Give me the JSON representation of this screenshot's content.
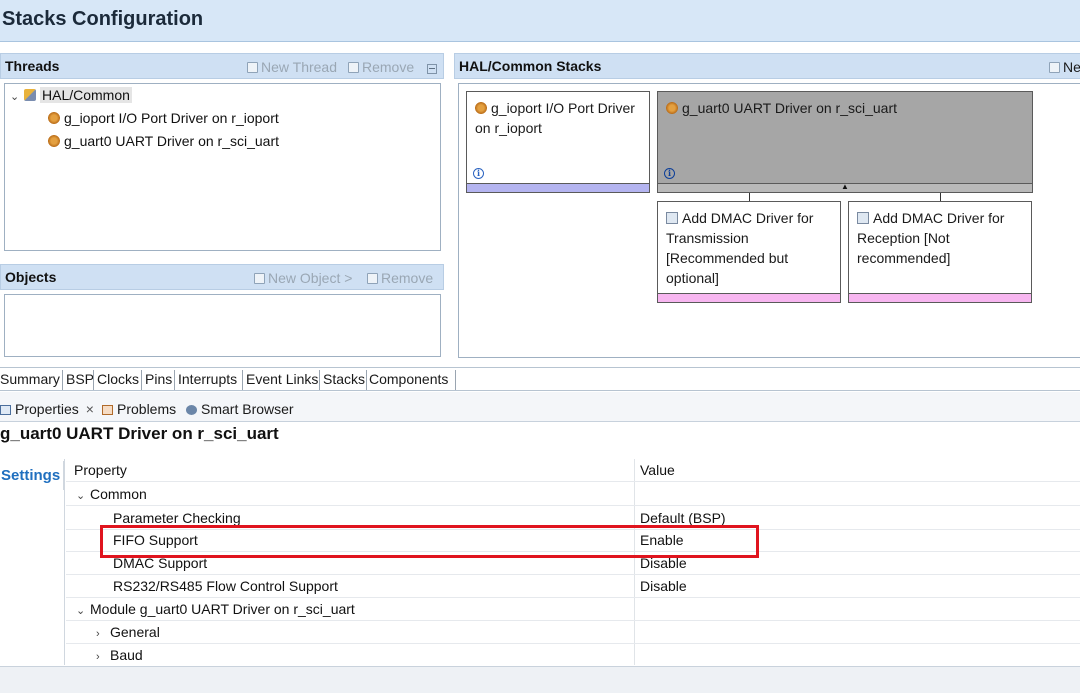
{
  "window": {
    "title": "Stacks Configuration"
  },
  "threads": {
    "header": "Threads",
    "new_thread": "New Thread",
    "remove": "Remove",
    "tree": {
      "root": "HAL/Common",
      "children": [
        "g_ioport I/O Port Driver on r_ioport",
        "g_uart0 UART Driver on r_sci_uart"
      ]
    }
  },
  "objects": {
    "header": "Objects",
    "new_object": "New Object >",
    "remove": "Remove"
  },
  "hal_stacks": {
    "header": "HAL/Common Stacks",
    "new_label": "Ne",
    "cards": {
      "ioport_line1": "g_ioport I/O Port Driver",
      "ioport_line2": "on r_ioport",
      "uart": "g_uart0 UART Driver on r_sci_uart",
      "dmac_tx_lines": [
        "Add DMAC Driver for",
        "Transmission",
        "[Recommended but",
        "optional]"
      ],
      "dmac_rx_lines": [
        "Add DMAC Driver for",
        "Reception [Not",
        "recommended]"
      ]
    },
    "colors": {
      "ioport_strip": "#b4b4f0",
      "uart_fill": "#a6a6a6",
      "dmac_strip": "#f7b6f0"
    }
  },
  "editor_tabs": [
    "Summary",
    "BSP",
    "Clocks",
    "Pins",
    "Interrupts",
    "Event Links",
    "Stacks",
    "Components"
  ],
  "view_tabs": {
    "properties": "Properties",
    "close": "×",
    "problems": "Problems",
    "smart_browser": "Smart Browser"
  },
  "properties": {
    "title": "g_uart0 UART Driver on r_sci_uart",
    "settings_tab": "Settings",
    "columns": {
      "property": "Property",
      "value": "Value"
    },
    "rows": [
      {
        "name": "Common",
        "value": ""
      },
      {
        "name": "Parameter Checking",
        "value": "Default (BSP)"
      },
      {
        "name": "FIFO Support",
        "value": "Enable"
      },
      {
        "name": "DMAC Support",
        "value": "Disable"
      },
      {
        "name": "RS232/RS485 Flow Control Support",
        "value": "Disable"
      },
      {
        "name": "Module g_uart0 UART Driver on r_sci_uart",
        "value": ""
      },
      {
        "name": "General",
        "value": ""
      },
      {
        "name": "Baud",
        "value": ""
      }
    ],
    "highlight_color": "#e0141e"
  }
}
